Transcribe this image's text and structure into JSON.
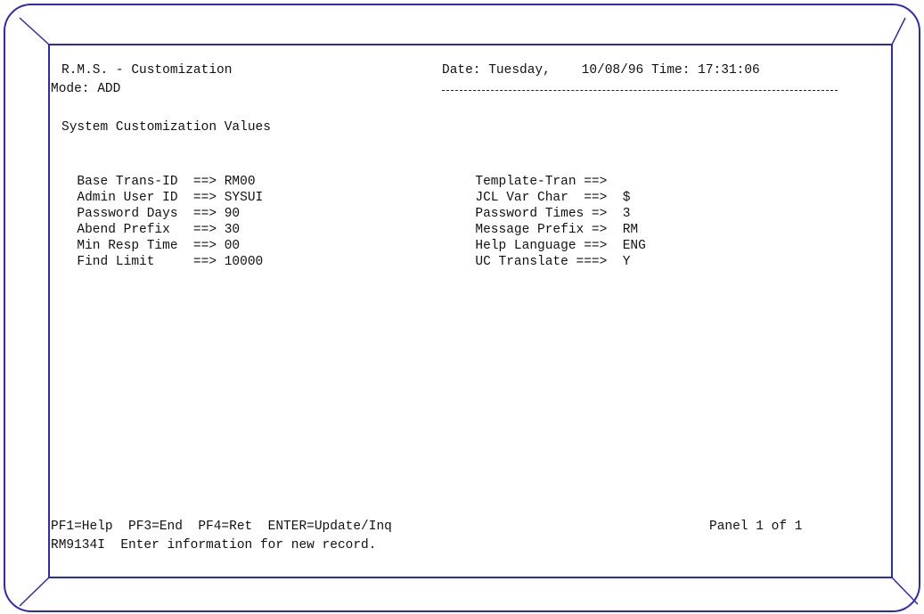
{
  "header": {
    "app_title": "R.M.S. - Customization",
    "mode": "Mode: ADD",
    "date_time": "Date: Tuesday,    10/08/96 Time: 17:31:06"
  },
  "section_title": "System Customization Values",
  "left_fields": [
    {
      "label": "Base Trans-ID  ==> ",
      "value": "RM00"
    },
    {
      "label": "Admin User ID  ==> ",
      "value": "SYSUI"
    },
    {
      "label": "Password Days  ==> ",
      "value": "90"
    },
    {
      "label": "Abend Prefix   ==> ",
      "value": "30"
    },
    {
      "label": "Min Resp Time  ==> ",
      "value": "00"
    },
    {
      "label": "Find Limit     ==> ",
      "value": "10000"
    }
  ],
  "right_fields": [
    {
      "label": "Template-Tran ==>  ",
      "value": ""
    },
    {
      "label": "JCL Var Char  ==>  ",
      "value": "$"
    },
    {
      "label": "Password Times =>  ",
      "value": "3"
    },
    {
      "label": "Message Prefix =>  ",
      "value": "RM"
    },
    {
      "label": "Help Language ==>  ",
      "value": "ENG"
    },
    {
      "label": "UC Translate ===>  ",
      "value": "Y"
    }
  ],
  "footer": {
    "pf_keys": "PF1=Help  PF3=End  PF4=Ret  ENTER=Update/Inq",
    "panel_info": "Panel 1 of 1",
    "message": "RM9134I  Enter information for new record."
  },
  "colors": {
    "bezel_line": "#2a2ab8",
    "text": "#111111",
    "background": "#ffffff"
  }
}
